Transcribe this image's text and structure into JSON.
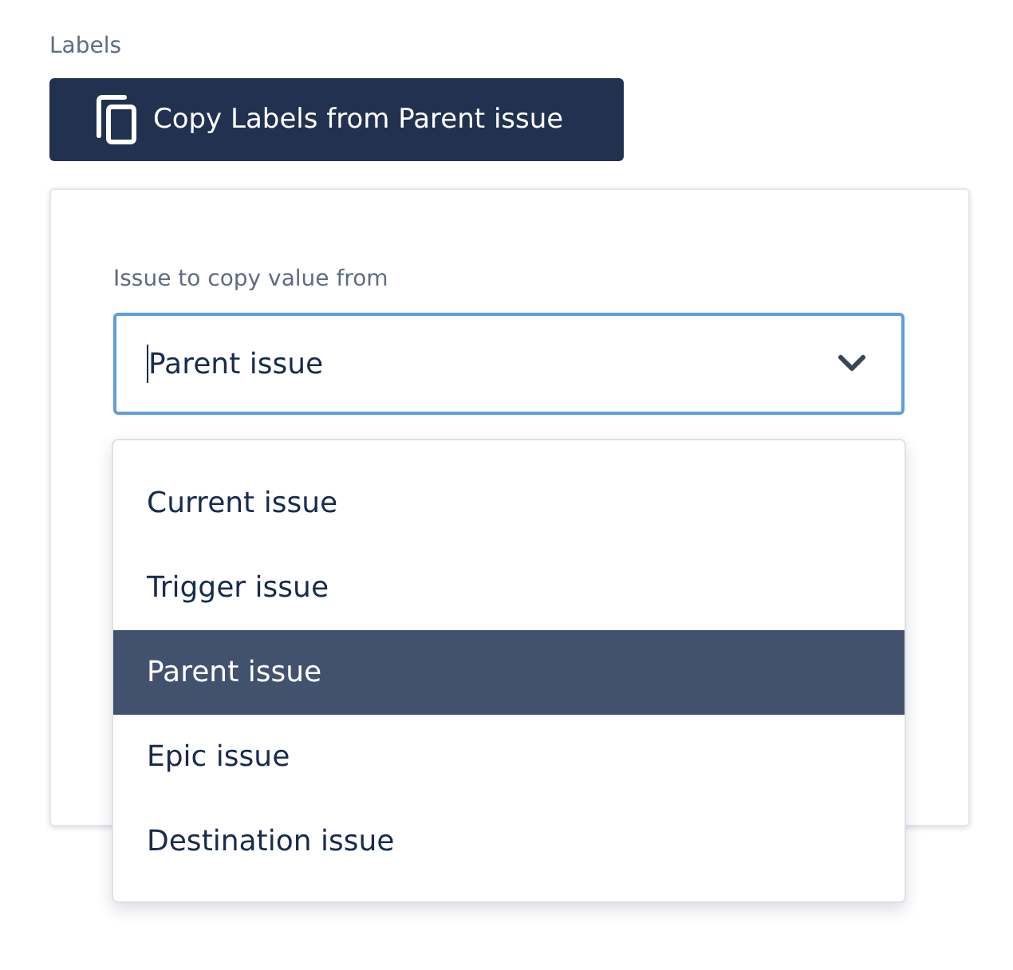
{
  "section_label": "Labels",
  "copy_button": {
    "label": "Copy Labels from Parent issue"
  },
  "card": {
    "field_label": "Issue to copy value from",
    "select": {
      "value": "Parent issue",
      "expanded": true
    },
    "options": [
      {
        "label": "Current issue",
        "selected": false
      },
      {
        "label": "Trigger issue",
        "selected": false
      },
      {
        "label": "Parent issue",
        "selected": true
      },
      {
        "label": "Epic issue",
        "selected": false
      },
      {
        "label": "Destination issue",
        "selected": false
      }
    ]
  }
}
